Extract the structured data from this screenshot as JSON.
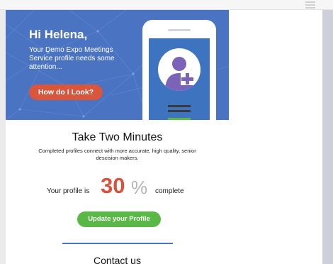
{
  "email": {
    "hero": {
      "greeting": "Hi Helena,",
      "line1": "Your Demo Expo Meetings",
      "line2": "Service profile needs some",
      "line3": "attention...",
      "button_label": "How do I Look?"
    },
    "title": "Take Two Minutes",
    "subtitle": "Completed profiles connect with more accurate, high quality, senior descision makers.",
    "progress": {
      "prefix": "Your profile is",
      "value": "30",
      "percent_sign": "%",
      "suffix": "complete"
    },
    "update_button_label": "Update your Profile",
    "contact_heading": "Contact us"
  },
  "colors": {
    "hero_blue": "#4a73c2",
    "accent_red": "#d9553b",
    "accent_green": "#5ab847",
    "avatar_purple": "#7b63b8"
  },
  "icons": {
    "menu": "hamburger-menu-icon",
    "avatar": "add-user-icon"
  }
}
